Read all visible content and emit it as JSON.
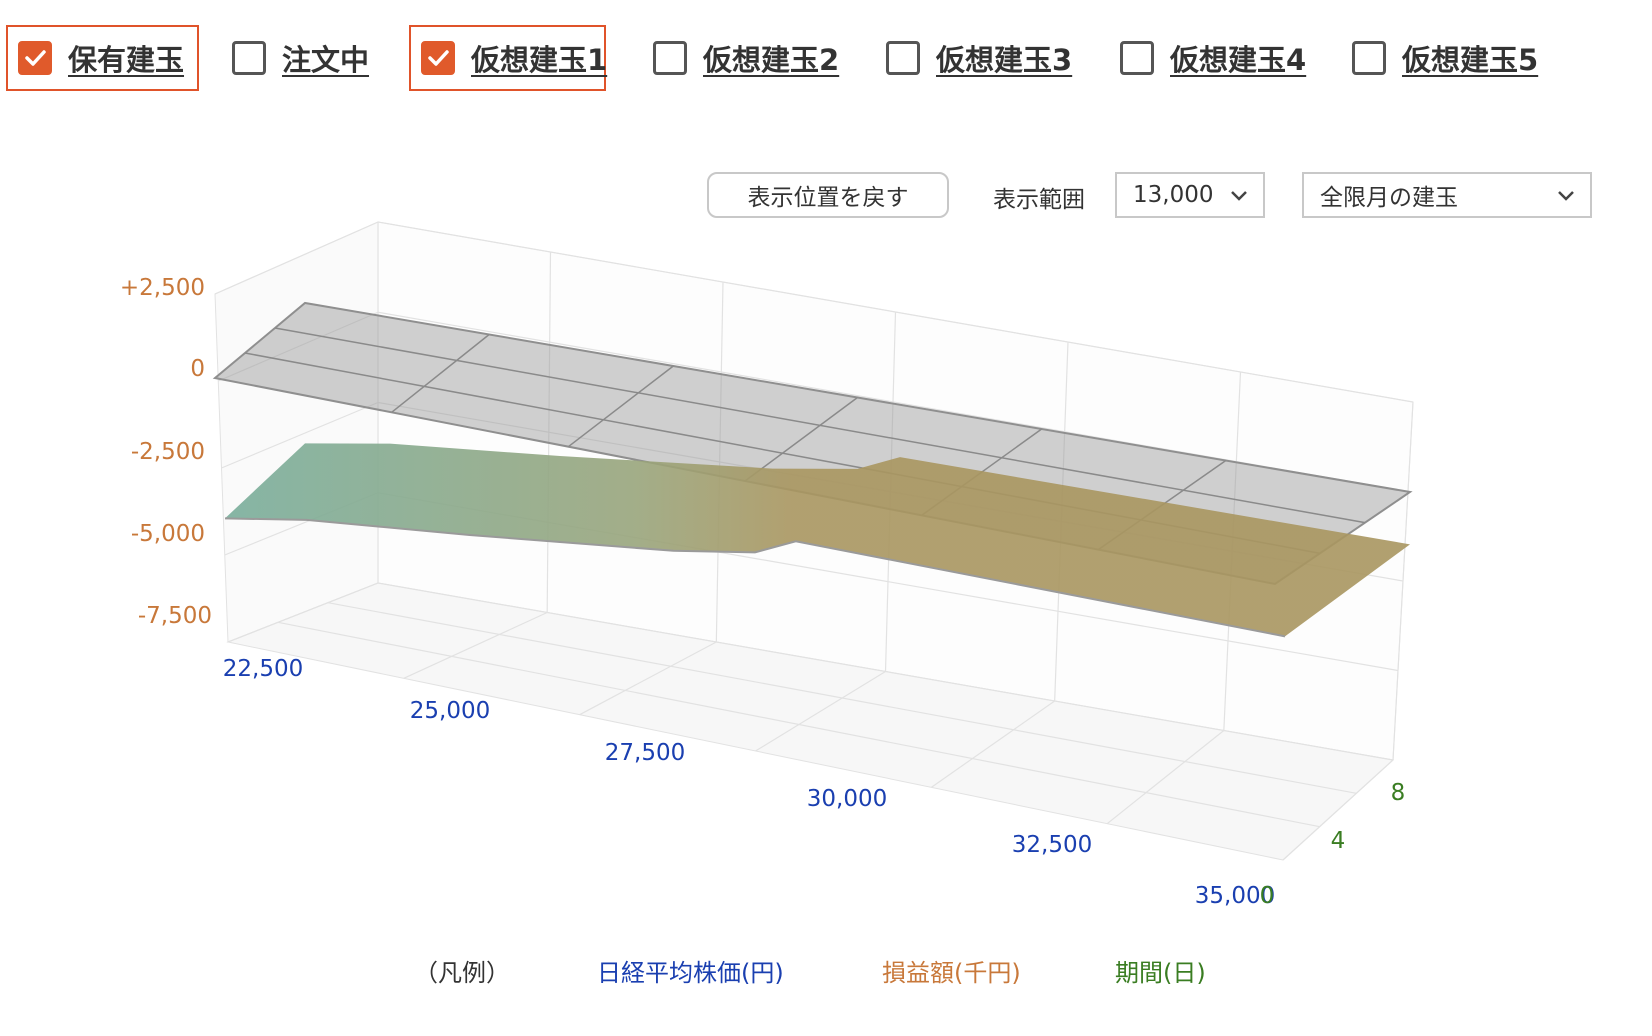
{
  "checkboxes": [
    {
      "label": "保有建玉",
      "checked": true
    },
    {
      "label": "注文中",
      "checked": false
    },
    {
      "label": "仮想建玉1",
      "checked": true
    },
    {
      "label": "仮想建玉2",
      "checked": false
    },
    {
      "label": "仮想建玉3",
      "checked": false
    },
    {
      "label": "仮想建玉4",
      "checked": false
    },
    {
      "label": "仮想建玉5",
      "checked": false
    }
  ],
  "controls": {
    "reset_label": "表示位置を戻す",
    "range_label": "表示範囲",
    "range_value": "13,000",
    "month_value": "全限月の建玉"
  },
  "chart_data": {
    "type": "3d-surface",
    "x_axis": {
      "label": "日経平均株価(円)",
      "ticks": [
        "22,500",
        "25,000",
        "27,500",
        "30,000",
        "32,500",
        "35,000"
      ],
      "color": "#1a3fb0"
    },
    "z_axis": {
      "label": "損益額(千円)",
      "ticks": [
        "+2,500",
        "0",
        "-2,500",
        "-5,000",
        "-7,500"
      ],
      "color": "#c8783a"
    },
    "y_axis": {
      "label": "期間(日)",
      "ticks": [
        "8",
        "4",
        "0"
      ],
      "color": "#3a7d22"
    },
    "profit_surface": {
      "x": [
        22000,
        23000,
        25000,
        27500,
        28500,
        29000,
        30000,
        32500,
        35000
      ],
      "pnl": [
        -5900,
        -5300,
        -4600,
        -3600,
        -3000,
        -2200,
        -2200,
        -2200,
        -2200
      ]
    },
    "zero_plane": 0
  },
  "legend": {
    "title": "（凡例）",
    "x": "日経平均株価(円)",
    "z": "損益額(千円)",
    "y": "期間(日)"
  },
  "colors": {
    "accent": "#e05a2b",
    "x_axis": "#1a3fb0",
    "z_axis": "#c8783a",
    "y_axis": "#3a7d22",
    "surface_low": "#79ae9c",
    "surface_high": "#a99660"
  }
}
